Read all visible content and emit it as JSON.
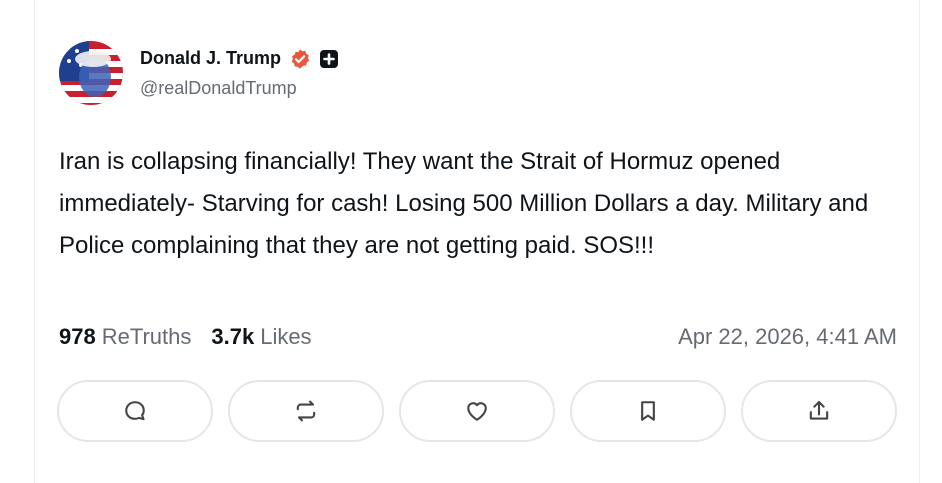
{
  "post": {
    "author_name": "Donald J. Trump",
    "author_handle": "@realDonaldTrump",
    "verified_icon": "verified-badge-icon",
    "plus_icon": "plus-square-icon",
    "text": "Iran is collapsing financially! They want the Strait of Hormuz opened immediately- Starving for cash! Losing 500 Million Dollars a day. Military and Police complaining that they are not getting paid. SOS!!!",
    "retruths_count": "978",
    "retruths_label": "ReTruths",
    "likes_count": "3.7k",
    "likes_label": "Likes",
    "timestamp": "Apr 22, 2026, 4:41 AM"
  },
  "actions": [
    {
      "name": "reply-button",
      "icon": "comment-icon"
    },
    {
      "name": "retruth-button",
      "icon": "repost-icon"
    },
    {
      "name": "like-button",
      "icon": "heart-icon"
    },
    {
      "name": "bookmark-button",
      "icon": "bookmark-icon"
    },
    {
      "name": "share-button",
      "icon": "share-icon"
    }
  ],
  "colors": {
    "accent": "#e9573f",
    "text": "#0f1419",
    "muted": "#666b73",
    "border": "#e6e6e9"
  }
}
